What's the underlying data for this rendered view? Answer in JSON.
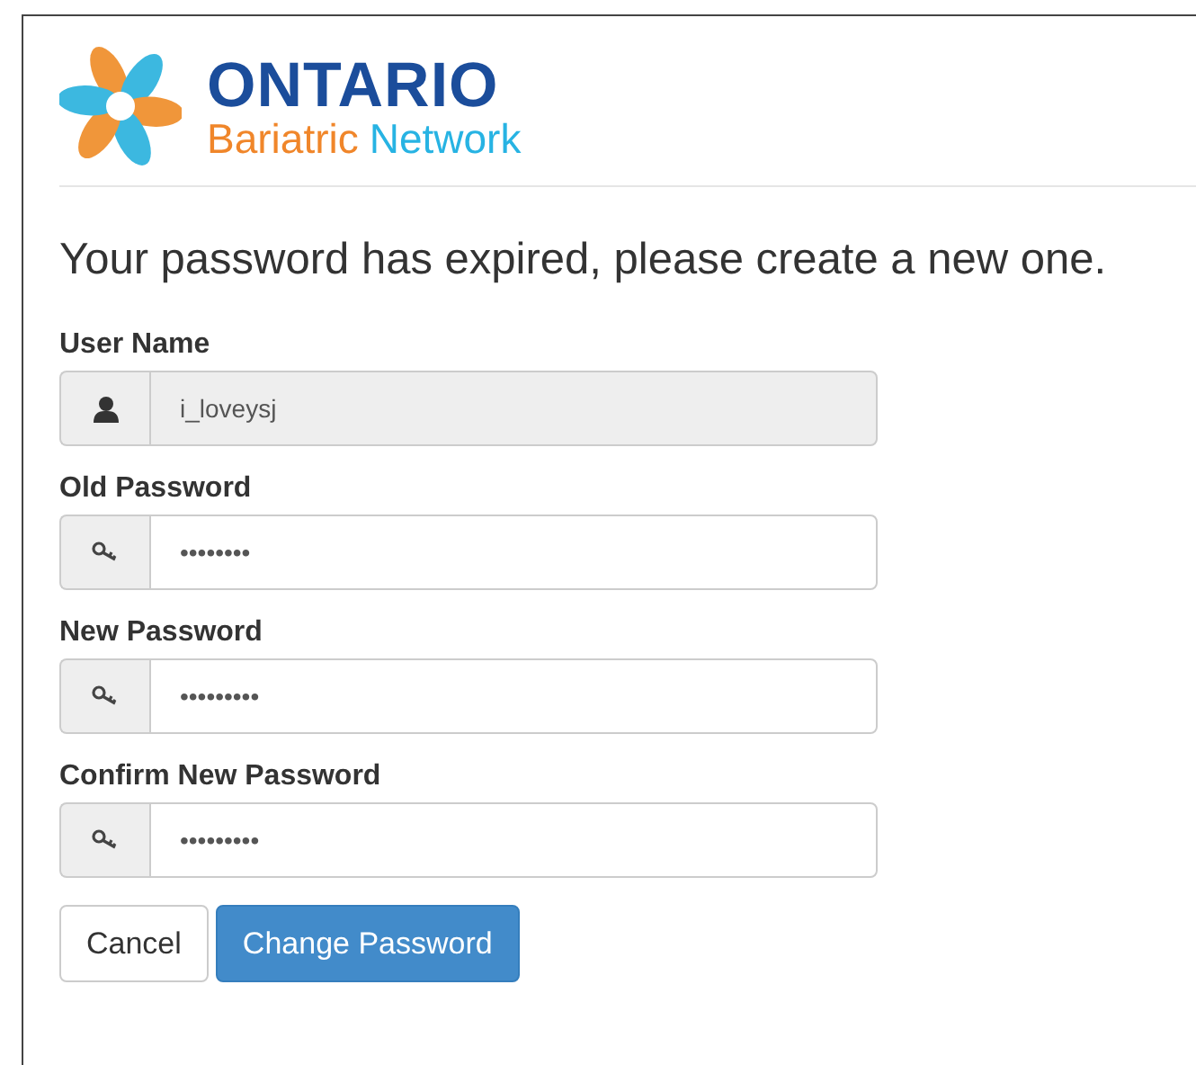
{
  "logo": {
    "title": "ONTARIO",
    "subtitle_first": "Bariatric",
    "subtitle_second": "Network"
  },
  "heading": "Your password has expired, please create a new one.",
  "fields": [
    {
      "label": "User Name",
      "kind": "user",
      "value": "i_loveysj",
      "disabled": true
    },
    {
      "label": "Old Password",
      "kind": "password",
      "value": "••••••••",
      "disabled": false
    },
    {
      "label": "New Password",
      "kind": "password",
      "value": "•••••••••",
      "disabled": false
    },
    {
      "label": "Confirm New Password",
      "kind": "password",
      "value": "•••••••••",
      "disabled": false
    }
  ],
  "buttons": [
    {
      "label": "Cancel",
      "kind": "default"
    },
    {
      "label": "Change Password",
      "kind": "primary"
    }
  ]
}
